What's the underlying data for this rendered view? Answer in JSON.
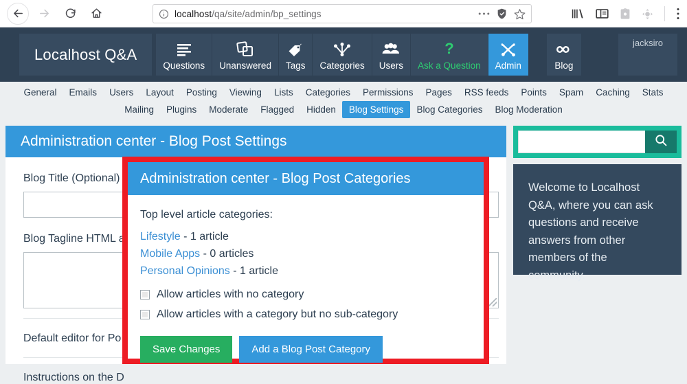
{
  "browser": {
    "back_icon": "back-arrow-icon",
    "forward_icon": "forward-arrow-icon",
    "reload_icon": "reload-icon",
    "home_icon": "home-icon",
    "url_host": "localhost",
    "url_path": "/qa/site/admin/bp_settings",
    "url_full": "localhost/qa/site/admin/bp_settings",
    "info_icon": "page-info-icon",
    "more_icon": "page-actions-ellipsis-icon",
    "shield_icon": "tracking-protection-shield-icon",
    "bookmark_icon": "bookmark-star-icon",
    "library_icon": "library-icon",
    "sidebar_icon": "sidebar-toggle-icon",
    "pocket_icon": "save-to-pocket-icon",
    "addon_icon": "addon-icon",
    "menu_icon": "app-menu-icon"
  },
  "site_nav": {
    "brand": "Localhost Q&A",
    "items": [
      {
        "label": "Questions",
        "icon": "list-lines-icon",
        "state": "normal"
      },
      {
        "label": "Unanswered",
        "icon": "cards-stack-icon",
        "state": "normal"
      },
      {
        "label": "Tags",
        "icon": "tag-icon",
        "state": "normal"
      },
      {
        "label": "Categories",
        "icon": "sitemap-icon",
        "state": "normal"
      },
      {
        "label": "Users",
        "icon": "users-group-icon",
        "state": "normal"
      },
      {
        "label": "Ask a Question",
        "icon": "question-mark-icon",
        "state": "accent"
      },
      {
        "label": "Admin",
        "icon": "tools-wrench-icon",
        "state": "active"
      },
      {
        "label": "Blog",
        "icon": "infinity-icon",
        "state": "normal"
      }
    ],
    "username": "jacksiro"
  },
  "admin_nav": {
    "row1": [
      "General",
      "Emails",
      "Users",
      "Layout",
      "Posting",
      "Viewing",
      "Lists",
      "Categories",
      "Permissions",
      "Pages",
      "RSS feeds",
      "Points",
      "Spam",
      "Caching",
      "Stats"
    ],
    "row2": [
      "Mailing",
      "Plugins",
      "Moderate",
      "Flagged",
      "Hidden",
      "Blog Settings",
      "Blog Categories",
      "Blog Moderation"
    ],
    "active": "Blog Settings"
  },
  "main": {
    "page_title": "Administration center - Blog Post Settings",
    "fields": [
      {
        "label": "Blog Title (Optional)",
        "value": "",
        "type": "text"
      },
      {
        "label": "Blog Tagline HTML a",
        "value": "",
        "type": "textarea"
      }
    ],
    "label_default_editor": "Default editor for Po",
    "label_instructions": "Instructions on the D"
  },
  "category_panel": {
    "title": "Administration center - Blog Post Categories",
    "intro": "Top level article categories:",
    "categories": [
      {
        "name": "Lifestyle",
        "count_text": "- 1 article"
      },
      {
        "name": "Mobile Apps",
        "count_text": "- 0 articles"
      },
      {
        "name": "Personal Opinions",
        "count_text": "- 1 article"
      }
    ],
    "checkboxes": [
      {
        "label": "Allow articles with no category",
        "checked": false
      },
      {
        "label": "Allow articles with a category but no sub-category",
        "checked": false
      }
    ],
    "save_label": "Save Changes",
    "add_label": "Add a Blog Post Category",
    "highlight_color": "#ed1c24"
  },
  "sidebar": {
    "search_placeholder": "",
    "search_value": "",
    "search_icon": "magnifier-icon",
    "welcome_text": "Welcome to Localhost Q&A, where you can ask questions and receive answers from other members of the community."
  },
  "colors": {
    "nav_dark": "#2f4154",
    "accent_blue": "#3498db",
    "accent_green": "#2ecc71",
    "teal": "#1abc9c",
    "save_green": "#27ae60",
    "highlight_red": "#ed1c24"
  }
}
